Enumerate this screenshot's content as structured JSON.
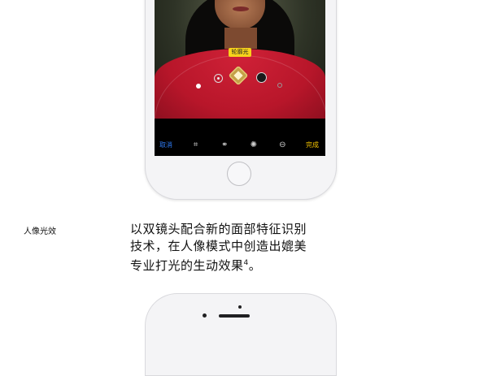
{
  "phone_screen": {
    "lighting_badge": "轮廓光",
    "toolbar": {
      "cancel_label": "取消",
      "done_label": "完成",
      "icons": [
        "crop-rotate-icon",
        "filters-icon",
        "adjust-icon",
        "edit-more-icon"
      ]
    },
    "modes": [
      "natural-light",
      "studio-light",
      "contour-light",
      "stage-light",
      "stage-light-mono"
    ]
  },
  "feature": {
    "label": "人像光效",
    "description_line1": "以双镜头配合新的面部特征识别",
    "description_line2": "技术，在人像模式中创造出媲美",
    "description_line3": "专业打光的生动效果",
    "footnote": "4",
    "period": "。"
  },
  "colors": {
    "cancel": "#2f7cf6",
    "done": "#f5c400",
    "badge": "#f7d21b"
  }
}
